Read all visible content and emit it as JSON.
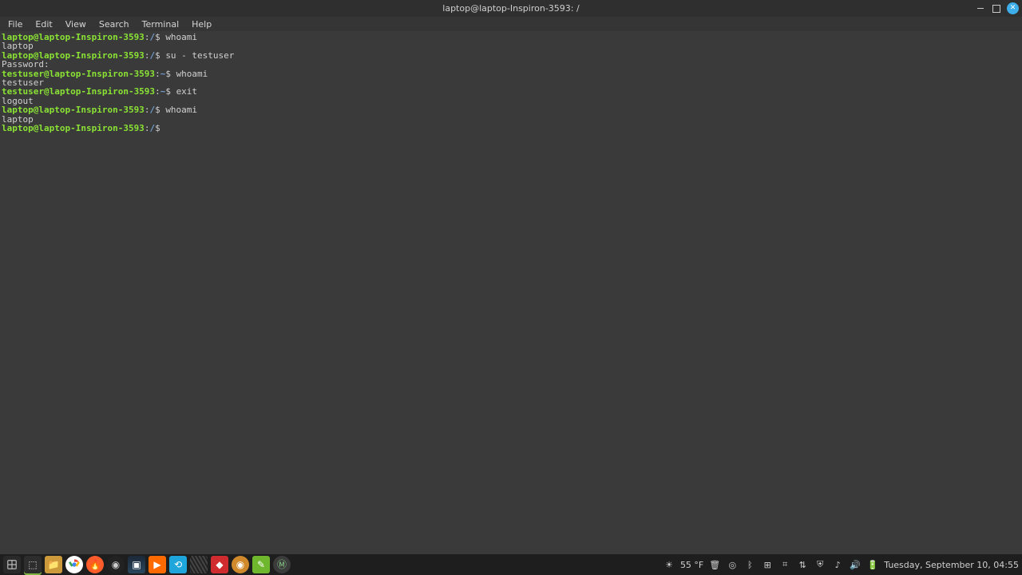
{
  "title": "laptop@laptop-Inspiron-3593: /",
  "menu": {
    "file": "File",
    "edit": "Edit",
    "view": "View",
    "search": "Search",
    "terminal": "Terminal",
    "help": "Help"
  },
  "prompt_user1": "laptop@laptop-Inspiron-3593",
  "prompt_user2": "testuser@laptop-Inspiron-3593",
  "path_root": "/",
  "path_home": "~",
  "prompt_sym": "$",
  "colon": ":",
  "cmds": {
    "whoami": "whoami",
    "su": "su - testuser",
    "exit": "exit"
  },
  "outputs": {
    "laptop": "laptop",
    "password": "Password:",
    "testuser": "testuser",
    "logout": "logout"
  },
  "taskbar": {
    "temp": "55 °F",
    "clock": "Tuesday, September 10, 04:55"
  }
}
